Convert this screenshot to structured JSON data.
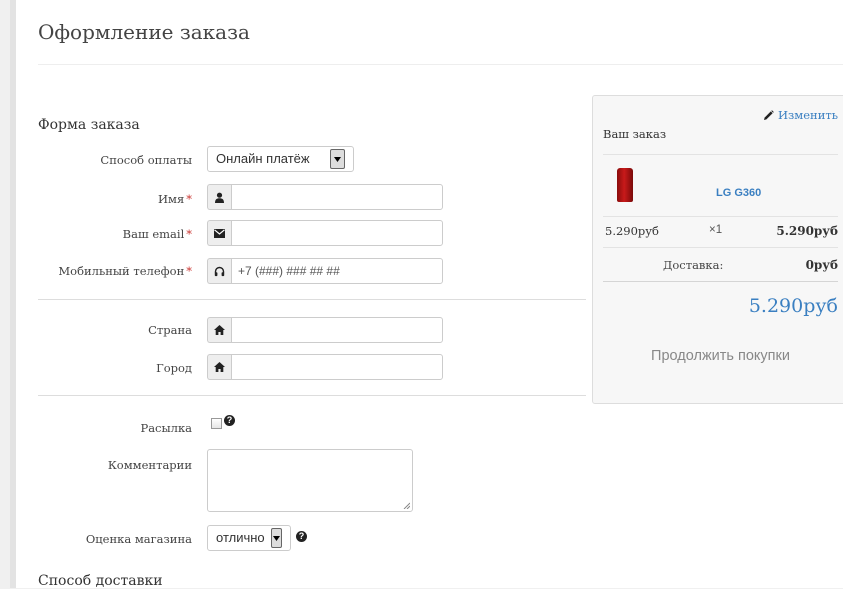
{
  "page": {
    "title": "Оформление заказа"
  },
  "form": {
    "section_title": "Форма заказа",
    "payment": {
      "label": "Способ оплаты",
      "value": "Онлайн платёж"
    },
    "name": {
      "label": "Имя",
      "required_mark": "*",
      "value": ""
    },
    "email": {
      "label": "Ваш email",
      "required_mark": "*",
      "value": ""
    },
    "phone": {
      "label": "Мобильный телефон",
      "required_mark": "*",
      "placeholder": "+7 (###) ### ## ##"
    },
    "country": {
      "label": "Страна",
      "value": ""
    },
    "city": {
      "label": "Город",
      "value": ""
    },
    "newsletter": {
      "label": "Расылка",
      "help": "?"
    },
    "comments": {
      "label": "Комментарии"
    },
    "rating": {
      "label": "Оценка магазина",
      "value": "отлично",
      "help": "?"
    }
  },
  "delivery": {
    "section_title": "Способ доставки"
  },
  "cart": {
    "edit_label": "Изменить",
    "heading": "Ваш заказ",
    "product": {
      "name": "LG G360",
      "price": "5.290руб",
      "qty": "×1",
      "sum": "5.290руб"
    },
    "delivery_label": "Доставка:",
    "delivery_value": "0руб",
    "total": "5.290руб",
    "continue_label": "Продолжить покупки"
  },
  "icons": {
    "name": "user-icon",
    "email": "envelope-icon",
    "phone": "headphones-icon",
    "country": "home-icon",
    "city": "home-icon",
    "edit": "pencil-icon",
    "help": "question-circle-icon"
  },
  "colors": {
    "link": "#3a7fc1",
    "required": "#c9302c"
  }
}
